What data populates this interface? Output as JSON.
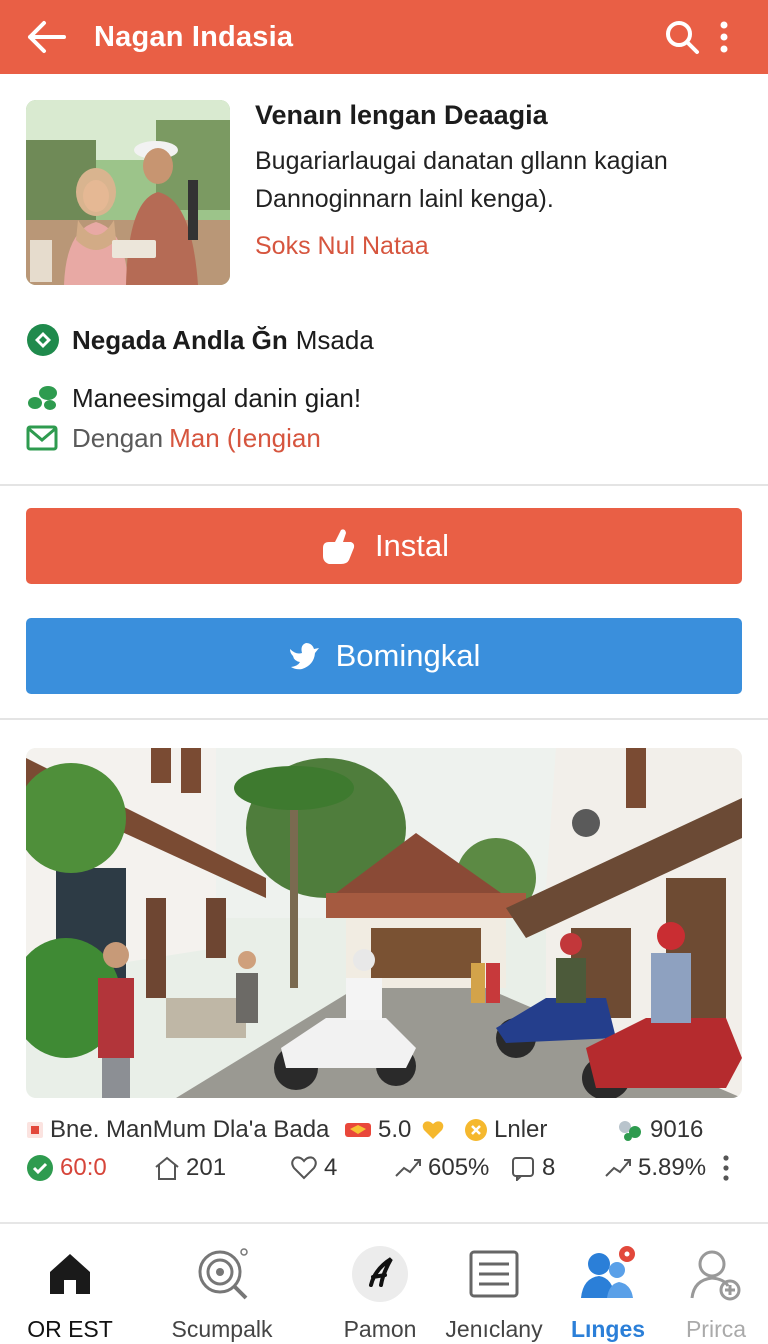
{
  "appbar": {
    "title": "Nagan Indasia",
    "back_icon": "arrow-left-icon",
    "search_icon": "search-icon",
    "more_icon": "more-vertical-icon",
    "color": "#e95f45"
  },
  "app": {
    "title": "Venaın lengan Deaagia",
    "description": "Bugariarlaugai danatan gllann kagian Dannoginnarn lainl kenga).",
    "link": "Soks Nul Nataa"
  },
  "meta": {
    "developer_strong": "Negada Andla Ğn",
    "developer_light": "Msada",
    "tagline": "Maneesimgal danin gian!",
    "contact_prefix": "Dengan",
    "contact_accent": "Man (Iengian"
  },
  "buttons": {
    "install": "Instal",
    "bookmark": "Bomingkal",
    "install_color": "#e95f45",
    "bookmark_color": "#3a8fdc"
  },
  "stats": {
    "row1": {
      "title": "Bne. ManMum Dla'a Bada",
      "rating": "5.0",
      "label": "Lnler",
      "count": "9016"
    },
    "row2": {
      "score": "60:0",
      "installs": "201",
      "likes": "4",
      "trend_a": "605%",
      "comments": "8",
      "trend_b": "5.89%"
    }
  },
  "nav": [
    {
      "label": "OR EST",
      "icon": "home-icon"
    },
    {
      "label": "Scumpalk",
      "icon": "target-search-icon"
    },
    {
      "label": "Pamon",
      "icon": "brush-icon"
    },
    {
      "label": "Jenıclany",
      "icon": "list-icon"
    },
    {
      "label": "Lınges",
      "icon": "people-icon"
    },
    {
      "label": "Prirca",
      "icon": "user-add-icon"
    }
  ]
}
